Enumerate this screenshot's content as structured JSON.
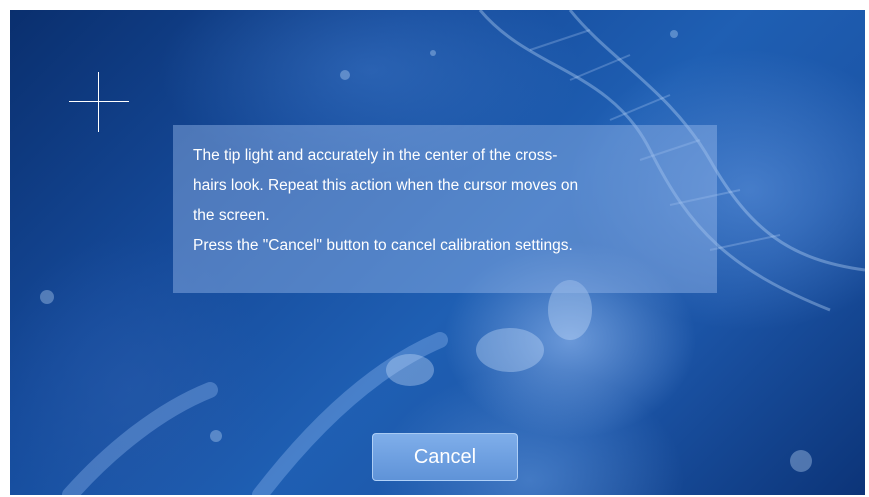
{
  "calibration": {
    "instructions": {
      "line1": "The tip light and accurately in the center of the cross-",
      "line2": "hairs look. Repeat this action when the cursor moves on",
      "line3": "the screen.",
      "line4": "Press the \"Cancel\" button to cancel calibration settings."
    },
    "crosshair_icon": "crosshair-icon",
    "cancel_label": "Cancel"
  },
  "colors": {
    "background_primary": "#154a9a",
    "panel_overlay": "#96b9eb",
    "button": "#6f9fe0",
    "text": "#ffffff"
  }
}
